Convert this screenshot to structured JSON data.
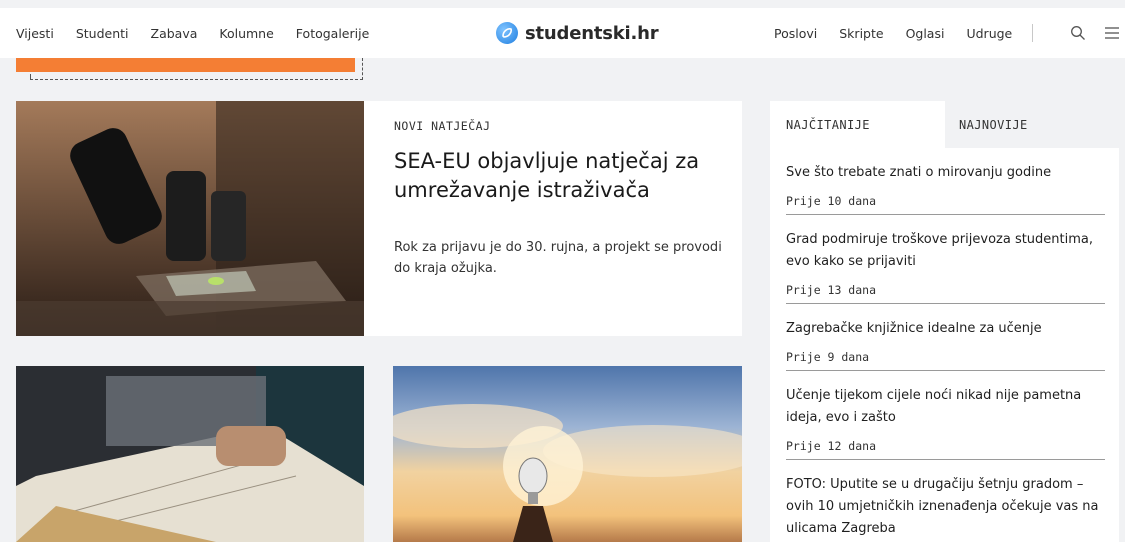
{
  "nav": {
    "left": [
      "Vijesti",
      "Studenti",
      "Zabava",
      "Kolumne",
      "Fotogalerije"
    ],
    "logo_text": "studentski.hr",
    "right": [
      "Poslovi",
      "Skripte",
      "Oglasi",
      "Udruge"
    ],
    "search_icon": "search-icon",
    "menu_icon": "hamburger-menu-icon"
  },
  "colors": {
    "accent": "#f47e34",
    "logo_blue": "#1f7fe0",
    "background": "#f1f2f4"
  },
  "featured": {
    "category": "NOVI NATJEČAJ",
    "title": "SEA-EU objavljuje natječaj za umrežavanje istraživača",
    "description": "Rok za prijavu je do 30. rujna, a projekt se provodi do kraja ožujka."
  },
  "sidebar": {
    "tabs": [
      "NAJČITANIJE",
      "NAJNOVIJE"
    ],
    "active_tab": "NAJČITANIJE",
    "items": [
      {
        "title": "Sve što trebate znati o mirovanju godine",
        "date": "Prije 10 dana"
      },
      {
        "title": "Grad podmiruje troškove prijevoza studentima, evo kako se prijaviti",
        "date": "Prije 13 dana"
      },
      {
        "title": "Zagrebačke knjižnice idealne za učenje",
        "date": "Prije 9 dana"
      },
      {
        "title": "Učenje tijekom cijele noći nikad nije pametna ideja, evo i zašto",
        "date": "Prije 12 dana"
      },
      {
        "title": "FOTO: Uputite se u drugačiju šetnju gradom – ovih 10 umjetničkih iznenađenja očekuje vas na ulicama Zagreba",
        "date": ""
      }
    ]
  }
}
